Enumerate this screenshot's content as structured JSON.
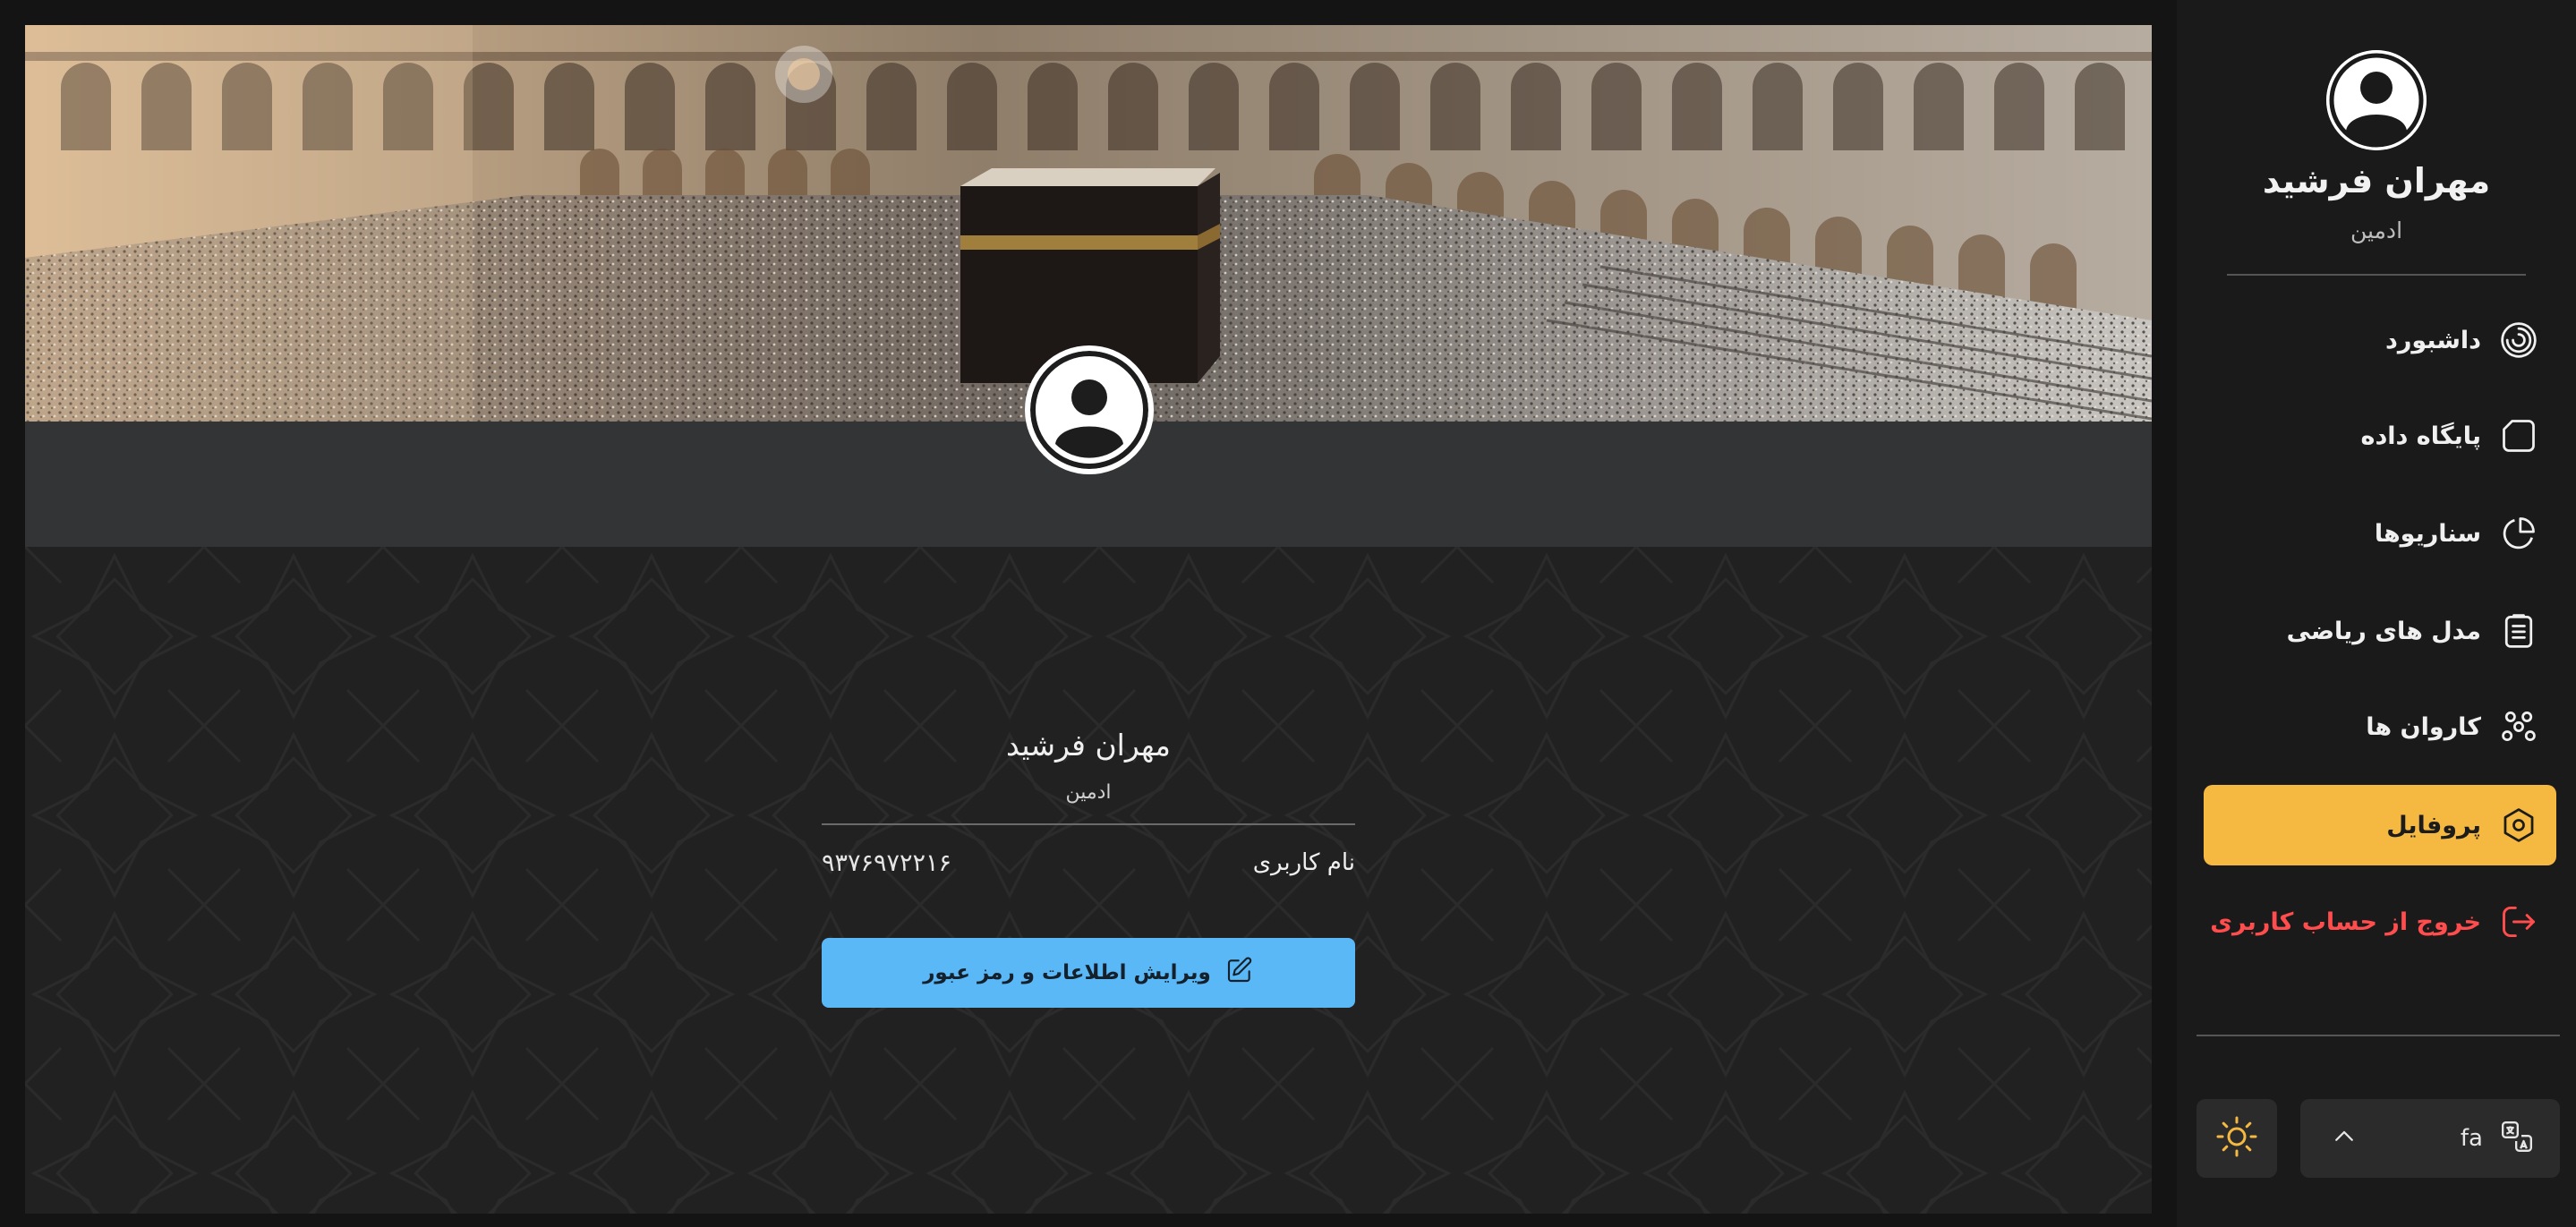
{
  "sidebar": {
    "user_name": "مهران فرشید",
    "user_role": "ادمین",
    "nav_items": [
      {
        "label": "داشبورد",
        "icon": "dashboard-icon"
      },
      {
        "label": "پایگاه داده",
        "icon": "database-icon"
      },
      {
        "label": "سناریوها",
        "icon": "pie-chart-icon"
      },
      {
        "label": "مدل های ریاضی",
        "icon": "clipboard-icon"
      },
      {
        "label": "کاروان ها",
        "icon": "caravans-icon"
      },
      {
        "label": "پروفایل",
        "icon": "hexagon-settings-icon",
        "active": true
      },
      {
        "label": "خروج از حساب کاربری",
        "icon": "logout-icon"
      }
    ],
    "language": {
      "code": "fa",
      "icon": "translate-icon"
    },
    "theme": {
      "icon": "sun-icon"
    }
  },
  "profile": {
    "name": "مهران فرشید",
    "role": "ادمین",
    "username_label": "نام کاربری",
    "username_value": "۹۳۷۶۹۷۲۲۱۶",
    "edit_button_label": "ویرایش اطلاعات و رمز عبور"
  },
  "colors": {
    "accent": "#f5b941",
    "primary_button": "#5bb8f6",
    "danger": "#ff4d4d",
    "background": "#222222",
    "sidebar": "#1a1a1a"
  }
}
